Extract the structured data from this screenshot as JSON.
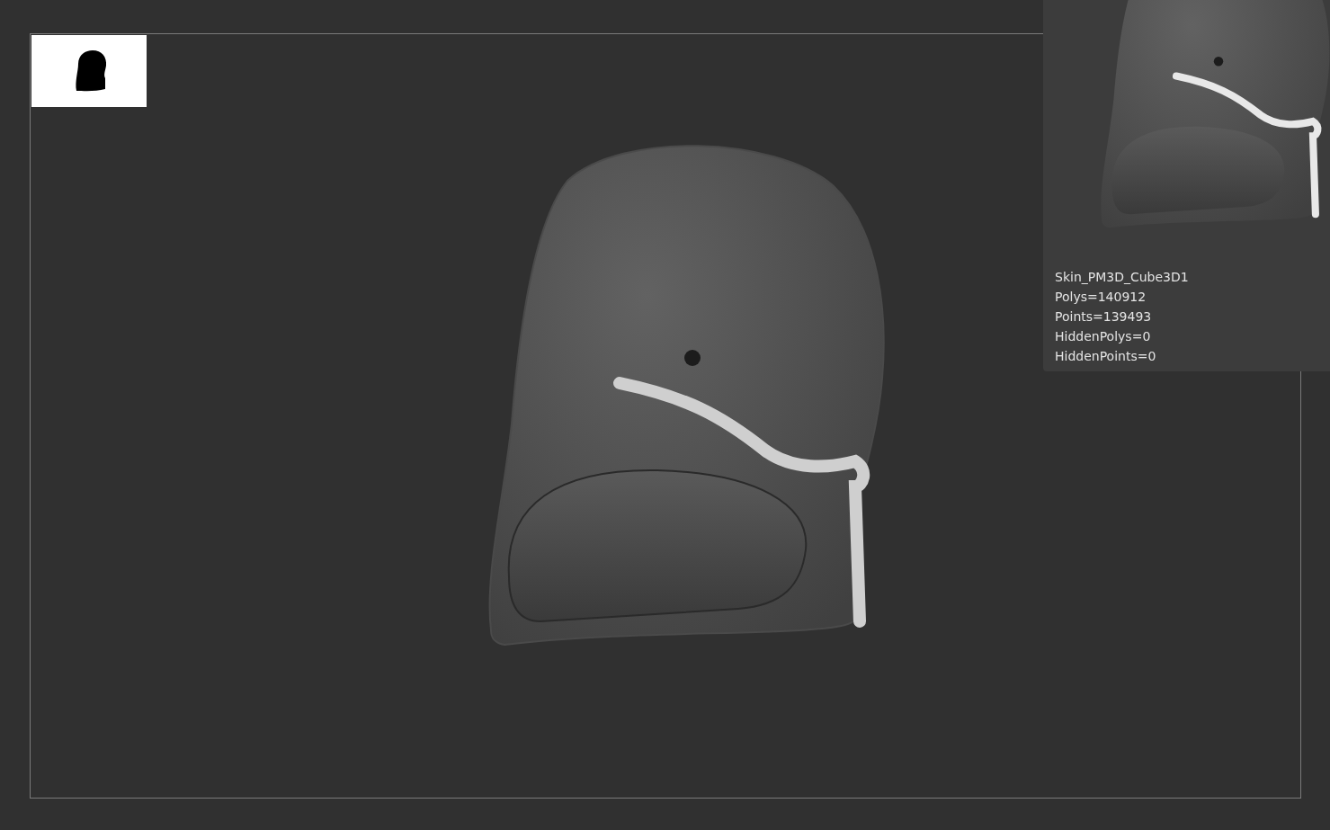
{
  "tool_info": {
    "name": "Skin_PM3D_Cube3D1",
    "stats": [
      "Polys=140912",
      "Points=139493",
      "HiddenPolys=0",
      "HiddenPoints=0"
    ]
  }
}
